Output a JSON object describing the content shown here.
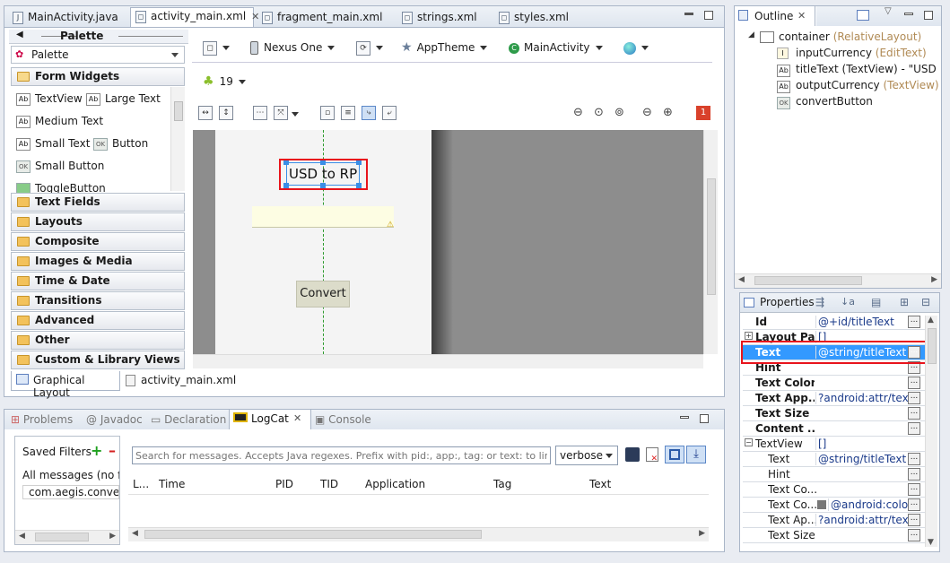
{
  "editor_tabs": [
    {
      "label": "MainActivity.java",
      "icon": "java-file-icon"
    },
    {
      "label": "activity_main.xml",
      "icon": "xml-file-icon",
      "active": true
    },
    {
      "label": "fragment_main.xml",
      "icon": "xml-file-icon"
    },
    {
      "label": "strings.xml",
      "icon": "xml-file-icon"
    },
    {
      "label": "styles.xml",
      "icon": "xml-file-icon"
    }
  ],
  "palette": {
    "header": "Palette",
    "dropdown": "Palette",
    "sections_open": "Form Widgets",
    "widgets": [
      "TextView",
      "Large Text",
      "Medium Text",
      "Small Text",
      "Button",
      "Small Button",
      "ToggleButton"
    ],
    "categories": [
      "Text Fields",
      "Layouts",
      "Composite",
      "Images & Media",
      "Time & Date",
      "Transitions",
      "Advanced",
      "Other",
      "Custom & Library Views"
    ]
  },
  "toolbar": {
    "device": "Nexus One",
    "theme": "AppTheme",
    "activity": "MainActivity",
    "api": "19",
    "error_count": "1"
  },
  "canvas": {
    "title_text": "USD to RP",
    "button_text": "Convert"
  },
  "bottom_editor_tabs": [
    "Graphical Layout",
    "activity_main.xml"
  ],
  "outline": {
    "title": "Outline",
    "root": "container",
    "root_type": "(RelativeLayout)",
    "children": [
      {
        "name": "inputCurrency",
        "type": "(EditText)"
      },
      {
        "name": "titleText (TextView) - \"USD to R",
        "type": ""
      },
      {
        "name": "outputCurrency",
        "type": "(TextView)"
      },
      {
        "name": "convertButton",
        "type": ""
      }
    ]
  },
  "properties": {
    "title": "Properties",
    "rows": [
      {
        "key": "Id",
        "value": "@+id/titleText",
        "bold": true
      },
      {
        "key": "Layout Pa...",
        "value": "[]",
        "bold": true
      },
      {
        "key": "Text",
        "value": "@string/titleText ...",
        "bold": true,
        "selected": true
      },
      {
        "key": "Hint",
        "value": "",
        "bold": true
      },
      {
        "key": "Text Color",
        "value": "",
        "bold": true
      },
      {
        "key": "Text App...",
        "value": "?android:attr/text...",
        "bold": true
      },
      {
        "key": "Text Size",
        "value": "",
        "bold": true
      },
      {
        "key": "Content ...",
        "value": "",
        "bold": true
      },
      {
        "key": "TextView",
        "value": "[]",
        "bold": false
      },
      {
        "key": "Text",
        "value": "@string/titleText ...",
        "bold": false
      },
      {
        "key": "Hint",
        "value": "",
        "bold": false
      },
      {
        "key": "Text Co...",
        "value": "",
        "bold": false
      },
      {
        "key": "Text Co...",
        "value": "@android:colo...",
        "bold": false
      },
      {
        "key": "Text Ap...",
        "value": "?android:attr/text...",
        "bold": false
      },
      {
        "key": "Text Size",
        "value": "",
        "bold": false
      }
    ]
  },
  "bottom_panel": {
    "tabs": [
      "Problems",
      "Javadoc",
      "Declaration",
      "LogCat",
      "Console"
    ],
    "saved_filters": "Saved Filters",
    "filters": [
      "All messages (no fil",
      "com.aegis.converte"
    ],
    "search_placeholder": "Search for messages. Accepts Java regexes. Prefix with pid:, app:, tag: or text: to limit scope.",
    "level": "verbose",
    "columns": [
      "L...",
      "Time",
      "PID",
      "TID",
      "Application",
      "Tag",
      "Text"
    ]
  },
  "colors": {
    "selection": "#3399ff",
    "highlight_box": "#e8141c"
  }
}
